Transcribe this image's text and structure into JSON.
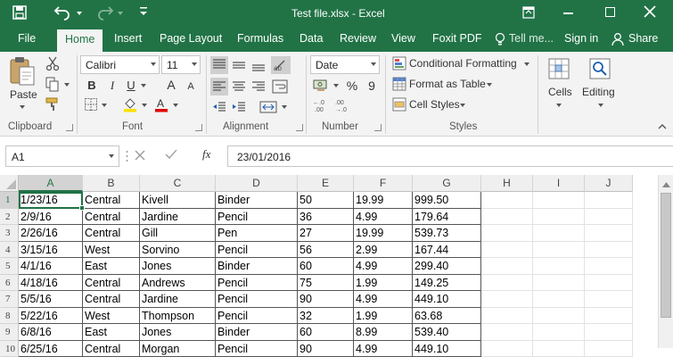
{
  "window": {
    "title": "Test file.xlsx - Excel"
  },
  "tabs": [
    "File",
    "Home",
    "Insert",
    "Page Layout",
    "Formulas",
    "Data",
    "Review",
    "View",
    "Foxit PDF"
  ],
  "tell_me": "Tell me...",
  "sign_in": "Sign in",
  "share": "Share",
  "ribbon": {
    "clipboard": {
      "paste": "Paste",
      "label": "Clipboard"
    },
    "font": {
      "name": "Calibri",
      "size": "11",
      "bold": "B",
      "italic": "I",
      "underline": "U",
      "grow": "A",
      "shrink": "A",
      "label": "Font"
    },
    "alignment": {
      "label": "Alignment"
    },
    "number": {
      "format": "Date",
      "percent": "%",
      "comma": "9",
      "label": "Number"
    },
    "styles": {
      "conditional": "Conditional Formatting",
      "format_table": "Format as Table",
      "cell_styles": "Cell Styles",
      "label": "Styles"
    },
    "cells": {
      "label": "Cells"
    },
    "editing": {
      "label": "Editing"
    }
  },
  "formula_bar": {
    "name_box": "A1",
    "fx": "fx",
    "value": "23/01/2016"
  },
  "grid": {
    "columns": [
      "A",
      "B",
      "C",
      "D",
      "E",
      "F",
      "G",
      "H",
      "I",
      "J"
    ],
    "rows": [
      {
        "num": "1",
        "cells": [
          "1/23/16",
          "Central",
          "Kivell",
          "Binder",
          "50",
          "19.99",
          "999.50"
        ]
      },
      {
        "num": "2",
        "cells": [
          "2/9/16",
          "Central",
          "Jardine",
          "Pencil",
          "36",
          "4.99",
          "179.64"
        ]
      },
      {
        "num": "3",
        "cells": [
          "2/26/16",
          "Central",
          "Gill",
          "Pen",
          "27",
          "19.99",
          "539.73"
        ]
      },
      {
        "num": "4",
        "cells": [
          "3/15/16",
          "West",
          "Sorvino",
          "Pencil",
          "56",
          "2.99",
          "167.44"
        ]
      },
      {
        "num": "5",
        "cells": [
          "4/1/16",
          "East",
          "Jones",
          "Binder",
          "60",
          "4.99",
          "299.40"
        ]
      },
      {
        "num": "6",
        "cells": [
          "4/18/16",
          "Central",
          "Andrews",
          "Pencil",
          "75",
          "1.99",
          "149.25"
        ]
      },
      {
        "num": "7",
        "cells": [
          "5/5/16",
          "Central",
          "Jardine",
          "Pencil",
          "90",
          "4.99",
          "449.10"
        ]
      },
      {
        "num": "8",
        "cells": [
          "5/22/16",
          "West",
          "Thompson",
          "Pencil",
          "32",
          "1.99",
          "63.68"
        ]
      },
      {
        "num": "9",
        "cells": [
          "6/8/16",
          "East",
          "Jones",
          "Binder",
          "60",
          "8.99",
          "539.40"
        ]
      },
      {
        "num": "10",
        "cells": [
          "6/25/16",
          "Central",
          "Morgan",
          "Pencil",
          "90",
          "4.99",
          "449.10"
        ]
      }
    ]
  },
  "colors": {
    "accent": "#217346"
  }
}
